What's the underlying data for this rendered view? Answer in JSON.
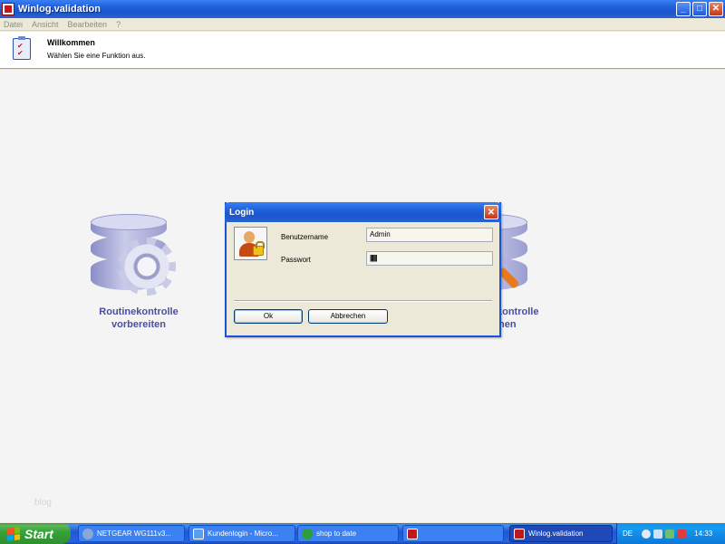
{
  "window": {
    "title": "Winlog.validation",
    "minimize": "_",
    "maximize": "□",
    "close": "✕"
  },
  "menu": [
    "Datei",
    "Ansicht",
    "Bearbeiten",
    "?"
  ],
  "header": {
    "title": "Willkommen",
    "subtitle": "Wählen Sie eine Funktion aus."
  },
  "tiles": [
    {
      "label_line1": "Routinekontrolle",
      "label_line2": "vorbereiten",
      "icon": "database-gear-icon"
    },
    {
      "label_line1": "kontrolle",
      "label_line2": "hen",
      "icon": "database-magnifier-icon"
    }
  ],
  "watermark": "blog",
  "login": {
    "title": "Login",
    "close": "✕",
    "username_label": "Benutzername",
    "username_value": "Admin",
    "password_label": "Passwort",
    "password_value": "||||||",
    "ok": "Ok",
    "cancel": "Abbrechen"
  },
  "taskbar": {
    "start": "Start",
    "items": [
      {
        "label": "NETGEAR WG111v3...",
        "icon": "network-icon"
      },
      {
        "label": "Kundenlogin - Micro...",
        "icon": "internet-explorer-icon"
      },
      {
        "label": "shop to date",
        "icon": "shop-icon"
      },
      {
        "label": "",
        "icon": "winlog-icon"
      },
      {
        "label": "Winlog.validation",
        "icon": "winlog-icon"
      }
    ],
    "tray": {
      "language": "DE",
      "clock": "14:33"
    }
  },
  "colors": {
    "xp_blue": "#1F5FD8",
    "tile_text": "#4B4F9E",
    "start_green": "#37A337"
  }
}
